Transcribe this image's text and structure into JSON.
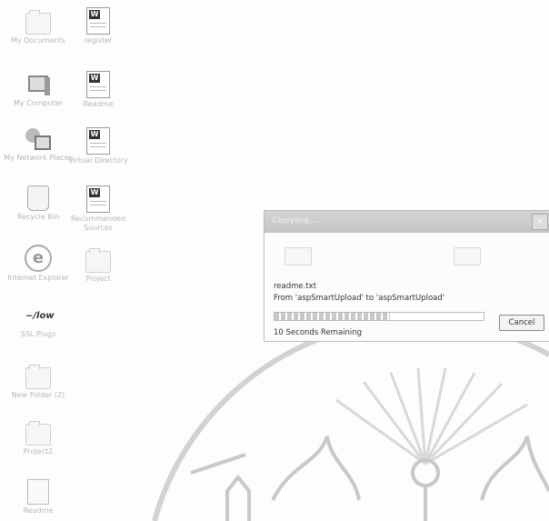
{
  "desktop": {
    "icons": [
      {
        "label": "My Documents",
        "icon": "folder-icon"
      },
      {
        "label": "register",
        "icon": "word-document-icon"
      },
      {
        "label": "My Computer",
        "icon": "computer-icon"
      },
      {
        "label": "Readme",
        "icon": "word-document-icon"
      },
      {
        "label": "My Network Places",
        "icon": "network-icon"
      },
      {
        "label": "Virtual Directory",
        "icon": "word-document-icon"
      },
      {
        "label": "Recycle Bin",
        "icon": "recycle-bin-icon"
      },
      {
        "label": "Recommended Sources",
        "icon": "word-document-icon"
      },
      {
        "label": "Internet Explorer",
        "icon": "internet-explorer-icon"
      },
      {
        "label": "Project",
        "icon": "folder-icon"
      },
      {
        "label": "SSL Plugs",
        "icon": "sketch-icon"
      },
      {
        "label": "New Folder (2)",
        "icon": "folder-icon"
      },
      {
        "label": "Project2",
        "icon": "folder-icon"
      },
      {
        "label": "Readme",
        "icon": "text-file-icon"
      }
    ]
  },
  "dialog": {
    "title": "Copying...",
    "close_glyph": "✕",
    "file_name": "readme.txt",
    "from_to": "From 'aspSmartUpload' to 'aspSmartUpload'",
    "time_remaining": "10 Seconds Remaining",
    "cancel_label": "Cancel",
    "progress": 0.55
  },
  "colors": {
    "desktop_bg": "#fdfdfd",
    "watermark": "#d8d8d8"
  }
}
